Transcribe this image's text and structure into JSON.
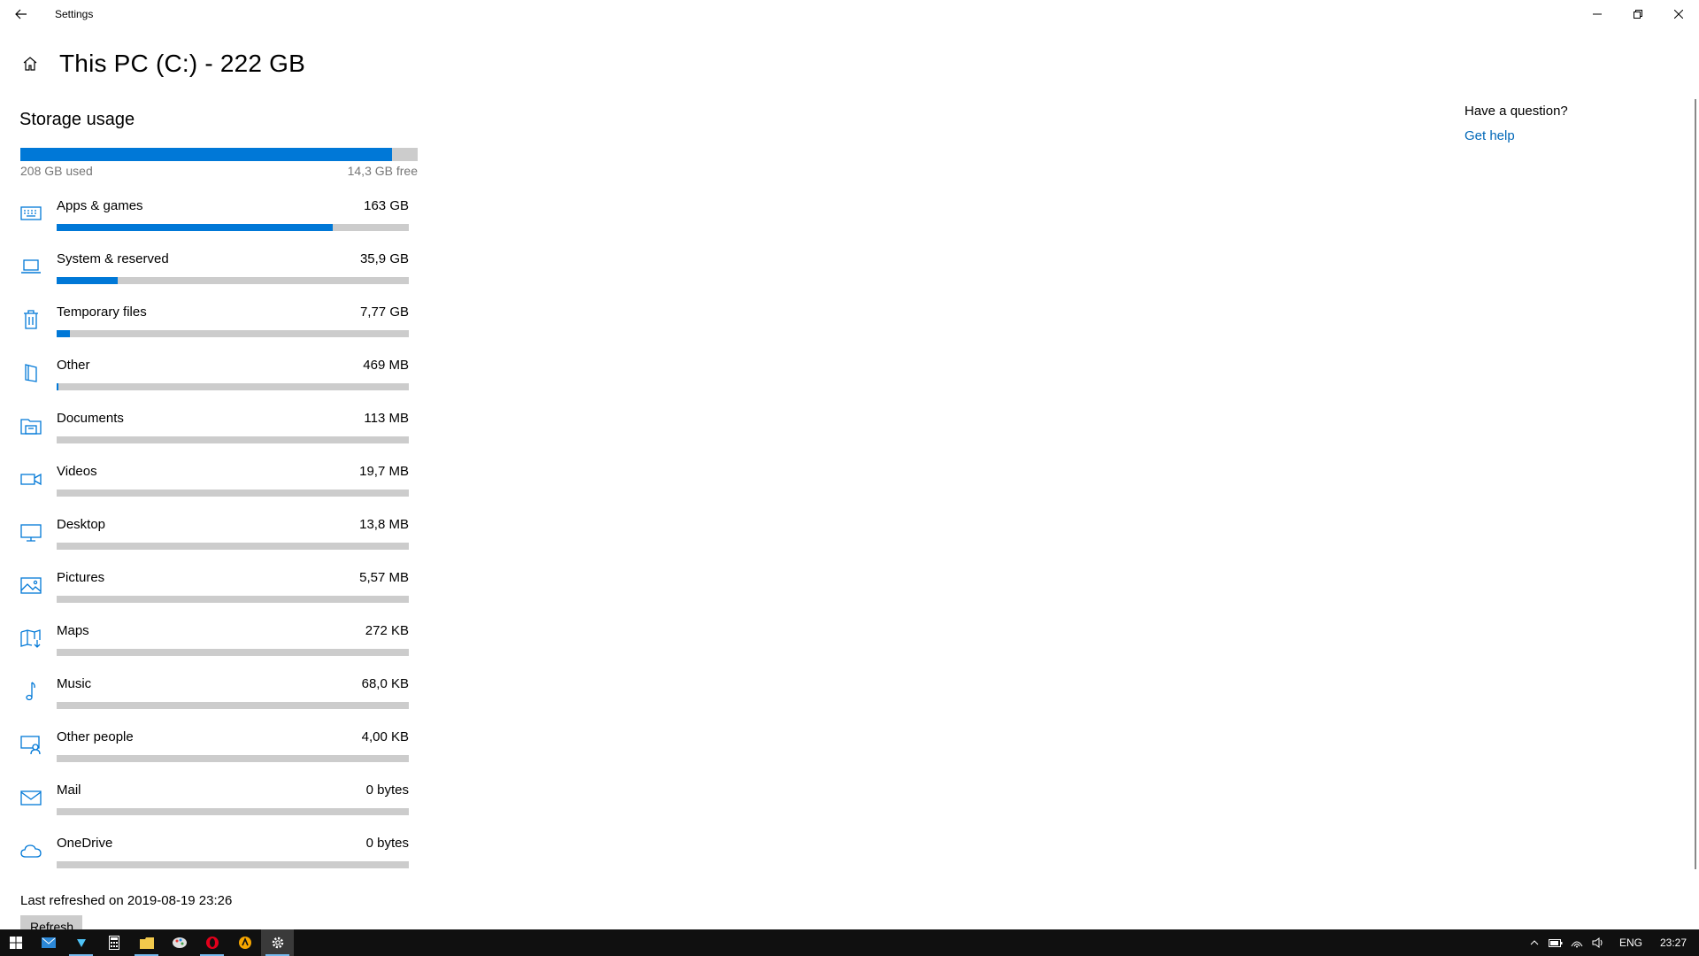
{
  "window": {
    "title": "Settings",
    "back_icon": "back-arrow-icon",
    "controls": [
      "minimize-icon",
      "restore-icon",
      "close-icon"
    ]
  },
  "header": {
    "home_icon": "home-icon",
    "title": "This PC (C:) - 222 GB"
  },
  "storage": {
    "section_title": "Storage usage",
    "used_label": "208 GB used",
    "free_label": "14,3 GB free",
    "used_fraction": 0.936
  },
  "categories": [
    {
      "name": "Apps & games",
      "size": "163 GB",
      "fraction": 0.784,
      "icon": "keyboard-icon"
    },
    {
      "name": "System & reserved",
      "size": "35,9 GB",
      "fraction": 0.173,
      "icon": "laptop-icon"
    },
    {
      "name": "Temporary files",
      "size": "7,77 GB",
      "fraction": 0.037,
      "icon": "trash-icon"
    },
    {
      "name": "Other",
      "size": "469 MB",
      "fraction": 0.003,
      "icon": "folder-other-icon"
    },
    {
      "name": "Documents",
      "size": "113 MB",
      "fraction": 0,
      "icon": "documents-icon"
    },
    {
      "name": "Videos",
      "size": "19,7 MB",
      "fraction": 0,
      "icon": "video-camera-icon"
    },
    {
      "name": "Desktop",
      "size": "13,8 MB",
      "fraction": 0,
      "icon": "monitor-icon"
    },
    {
      "name": "Pictures",
      "size": "5,57 MB",
      "fraction": 0,
      "icon": "picture-icon"
    },
    {
      "name": "Maps",
      "size": "272 KB",
      "fraction": 0,
      "icon": "map-icon"
    },
    {
      "name": "Music",
      "size": "68,0 KB",
      "fraction": 0,
      "icon": "music-note-icon"
    },
    {
      "name": "Other people",
      "size": "4,00 KB",
      "fraction": 0,
      "icon": "other-people-icon"
    },
    {
      "name": "Mail",
      "size": "0 bytes",
      "fraction": 0,
      "icon": "mail-icon"
    },
    {
      "name": "OneDrive",
      "size": "0 bytes",
      "fraction": 0,
      "icon": "cloud-icon"
    }
  ],
  "footer": {
    "last_refreshed": "Last refreshed on 2019-08-19 23:26",
    "refresh_button": "Refresh"
  },
  "help": {
    "question": "Have a question?",
    "link": "Get help"
  },
  "taskbar": {
    "language": "ENG",
    "clock": "23:27",
    "colors": {
      "accent": "#0078d7",
      "taskbar_bg": "#101010"
    }
  }
}
